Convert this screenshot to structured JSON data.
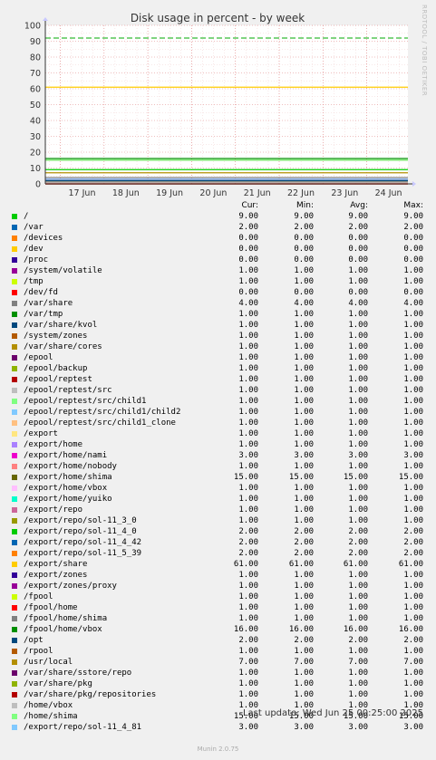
{
  "chart_data": {
    "type": "line",
    "title": "Disk usage in percent - by week",
    "ylim": [
      0,
      100
    ],
    "yticks": [
      0,
      10,
      20,
      30,
      40,
      50,
      60,
      70,
      80,
      90,
      100
    ],
    "xlabels": [
      "17 Jun",
      "18 Jun",
      "19 Jun",
      "20 Jun",
      "21 Jun",
      "22 Jun",
      "23 Jun",
      "24 Jun"
    ],
    "warning_line": 92,
    "grid": true,
    "columns": [
      "Cur:",
      "Min:",
      "Avg:",
      "Max:"
    ],
    "series": [
      {
        "name": "/",
        "color": "#00cc00",
        "cur": "9.00",
        "min": "9.00",
        "avg": "9.00",
        "max": "9.00"
      },
      {
        "name": "/var",
        "color": "#0066b3",
        "cur": "2.00",
        "min": "2.00",
        "avg": "2.00",
        "max": "2.00"
      },
      {
        "name": "/devices",
        "color": "#ff8000",
        "cur": "0.00",
        "min": "0.00",
        "avg": "0.00",
        "max": "0.00"
      },
      {
        "name": "/dev",
        "color": "#ffcc00",
        "cur": "0.00",
        "min": "0.00",
        "avg": "0.00",
        "max": "0.00"
      },
      {
        "name": "/proc",
        "color": "#330099",
        "cur": "0.00",
        "min": "0.00",
        "avg": "0.00",
        "max": "0.00"
      },
      {
        "name": "/system/volatile",
        "color": "#990099",
        "cur": "1.00",
        "min": "1.00",
        "avg": "1.00",
        "max": "1.00"
      },
      {
        "name": "/tmp",
        "color": "#ccff00",
        "cur": "1.00",
        "min": "1.00",
        "avg": "1.00",
        "max": "1.00"
      },
      {
        "name": "/dev/fd",
        "color": "#ff0000",
        "cur": "0.00",
        "min": "0.00",
        "avg": "0.00",
        "max": "0.00"
      },
      {
        "name": "/var/share",
        "color": "#808080",
        "cur": "4.00",
        "min": "4.00",
        "avg": "4.00",
        "max": "4.00"
      },
      {
        "name": "/var/tmp",
        "color": "#008f00",
        "cur": "1.00",
        "min": "1.00",
        "avg": "1.00",
        "max": "1.00"
      },
      {
        "name": "/var/share/kvol",
        "color": "#00487d",
        "cur": "1.00",
        "min": "1.00",
        "avg": "1.00",
        "max": "1.00"
      },
      {
        "name": "/system/zones",
        "color": "#b35a00",
        "cur": "1.00",
        "min": "1.00",
        "avg": "1.00",
        "max": "1.00"
      },
      {
        "name": "/var/share/cores",
        "color": "#b38f00",
        "cur": "1.00",
        "min": "1.00",
        "avg": "1.00",
        "max": "1.00"
      },
      {
        "name": "/epool",
        "color": "#6b006b",
        "cur": "1.00",
        "min": "1.00",
        "avg": "1.00",
        "max": "1.00"
      },
      {
        "name": "/epool/backup",
        "color": "#8fb300",
        "cur": "1.00",
        "min": "1.00",
        "avg": "1.00",
        "max": "1.00"
      },
      {
        "name": "/epool/reptest",
        "color": "#b30000",
        "cur": "1.00",
        "min": "1.00",
        "avg": "1.00",
        "max": "1.00"
      },
      {
        "name": "/epool/reptest/src",
        "color": "#bebebe",
        "cur": "1.00",
        "min": "1.00",
        "avg": "1.00",
        "max": "1.00"
      },
      {
        "name": "/epool/reptest/src/child1",
        "color": "#80ff80",
        "cur": "1.00",
        "min": "1.00",
        "avg": "1.00",
        "max": "1.00"
      },
      {
        "name": "/epool/reptest/src/child1/child2",
        "color": "#80c9ff",
        "cur": "1.00",
        "min": "1.00",
        "avg": "1.00",
        "max": "1.00"
      },
      {
        "name": "/epool/reptest/src/child1_clone",
        "color": "#ffc080",
        "cur": "1.00",
        "min": "1.00",
        "avg": "1.00",
        "max": "1.00"
      },
      {
        "name": "/export",
        "color": "#ffe680",
        "cur": "1.00",
        "min": "1.00",
        "avg": "1.00",
        "max": "1.00"
      },
      {
        "name": "/export/home",
        "color": "#aa80ff",
        "cur": "1.00",
        "min": "1.00",
        "avg": "1.00",
        "max": "1.00"
      },
      {
        "name": "/export/home/nami",
        "color": "#ee00cc",
        "cur": "3.00",
        "min": "3.00",
        "avg": "3.00",
        "max": "3.00"
      },
      {
        "name": "/export/home/nobody",
        "color": "#ff8080",
        "cur": "1.00",
        "min": "1.00",
        "avg": "1.00",
        "max": "1.00"
      },
      {
        "name": "/export/home/shima",
        "color": "#666600",
        "cur": "15.00",
        "min": "15.00",
        "avg": "15.00",
        "max": "15.00"
      },
      {
        "name": "/export/home/vbox",
        "color": "#ffbfff",
        "cur": "1.00",
        "min": "1.00",
        "avg": "1.00",
        "max": "1.00"
      },
      {
        "name": "/export/home/yuiko",
        "color": "#00ffcc",
        "cur": "1.00",
        "min": "1.00",
        "avg": "1.00",
        "max": "1.00"
      },
      {
        "name": "/export/repo",
        "color": "#cc6699",
        "cur": "1.00",
        "min": "1.00",
        "avg": "1.00",
        "max": "1.00"
      },
      {
        "name": "/export/repo/sol-11_3_0",
        "color": "#999900",
        "cur": "1.00",
        "min": "1.00",
        "avg": "1.00",
        "max": "1.00"
      },
      {
        "name": "/export/repo/sol-11_4_0",
        "color": "#00cc00",
        "cur": "2.00",
        "min": "2.00",
        "avg": "2.00",
        "max": "2.00"
      },
      {
        "name": "/export/repo/sol-11_4_42",
        "color": "#0066b3",
        "cur": "2.00",
        "min": "2.00",
        "avg": "2.00",
        "max": "2.00"
      },
      {
        "name": "/export/repo/sol-11_5_39",
        "color": "#ff8000",
        "cur": "2.00",
        "min": "2.00",
        "avg": "2.00",
        "max": "2.00"
      },
      {
        "name": "/export/share",
        "color": "#ffcc00",
        "cur": "61.00",
        "min": "61.00",
        "avg": "61.00",
        "max": "61.00"
      },
      {
        "name": "/export/zones",
        "color": "#330099",
        "cur": "1.00",
        "min": "1.00",
        "avg": "1.00",
        "max": "1.00"
      },
      {
        "name": "/export/zones/proxy",
        "color": "#990099",
        "cur": "1.00",
        "min": "1.00",
        "avg": "1.00",
        "max": "1.00"
      },
      {
        "name": "/fpool",
        "color": "#ccff00",
        "cur": "1.00",
        "min": "1.00",
        "avg": "1.00",
        "max": "1.00"
      },
      {
        "name": "/fpool/home",
        "color": "#ff0000",
        "cur": "1.00",
        "min": "1.00",
        "avg": "1.00",
        "max": "1.00"
      },
      {
        "name": "/fpool/home/shima",
        "color": "#808080",
        "cur": "1.00",
        "min": "1.00",
        "avg": "1.00",
        "max": "1.00"
      },
      {
        "name": "/fpool/home/vbox",
        "color": "#008f00",
        "cur": "16.00",
        "min": "16.00",
        "avg": "16.00",
        "max": "16.00"
      },
      {
        "name": "/opt",
        "color": "#00487d",
        "cur": "2.00",
        "min": "2.00",
        "avg": "2.00",
        "max": "2.00"
      },
      {
        "name": "/rpool",
        "color": "#b35a00",
        "cur": "1.00",
        "min": "1.00",
        "avg": "1.00",
        "max": "1.00"
      },
      {
        "name": "/usr/local",
        "color": "#b38f00",
        "cur": "7.00",
        "min": "7.00",
        "avg": "7.00",
        "max": "7.00"
      },
      {
        "name": "/var/share/sstore/repo",
        "color": "#6b006b",
        "cur": "1.00",
        "min": "1.00",
        "avg": "1.00",
        "max": "1.00"
      },
      {
        "name": "/var/share/pkg",
        "color": "#8fb300",
        "cur": "1.00",
        "min": "1.00",
        "avg": "1.00",
        "max": "1.00"
      },
      {
        "name": "/var/share/pkg/repositories",
        "color": "#b30000",
        "cur": "1.00",
        "min": "1.00",
        "avg": "1.00",
        "max": "1.00"
      },
      {
        "name": "/home/vbox",
        "color": "#bebebe",
        "cur": "1.00",
        "min": "1.00",
        "avg": "1.00",
        "max": "1.00"
      },
      {
        "name": "/home/shima",
        "color": "#80ff80",
        "cur": "15.00",
        "min": "15.00",
        "avg": "15.00",
        "max": "15.00"
      },
      {
        "name": "/export/repo/sol-11_4_81",
        "color": "#80c9ff",
        "cur": "3.00",
        "min": "3.00",
        "avg": "3.00",
        "max": "3.00"
      }
    ]
  },
  "footer": {
    "last_update": "Last update: Wed Jun 25 00:25:00 2025",
    "generator": "Munin 2.0.75",
    "side_label": "RRDTOOL / TOBI OETIKER"
  }
}
